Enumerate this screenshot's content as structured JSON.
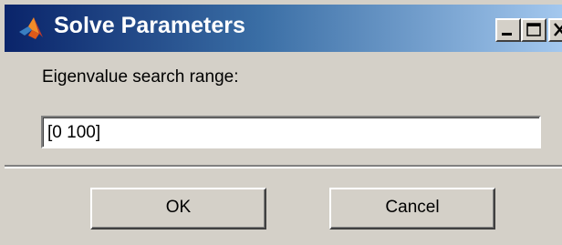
{
  "window": {
    "title": "Solve Parameters",
    "title_bar_colors": {
      "start": "#0a246a",
      "end": "#a6caf0"
    },
    "face_color": "#d4d0c8",
    "controls": {
      "minimize_icon": "minimize-icon",
      "maximize_icon": "maximize-icon",
      "close_icon": "close-icon"
    },
    "app_icon": "matlab-logo-icon"
  },
  "form": {
    "range_label": "Eigenvalue search range:",
    "range_value": "[0 100]"
  },
  "buttons": {
    "ok_label": "OK",
    "cancel_label": "Cancel"
  }
}
